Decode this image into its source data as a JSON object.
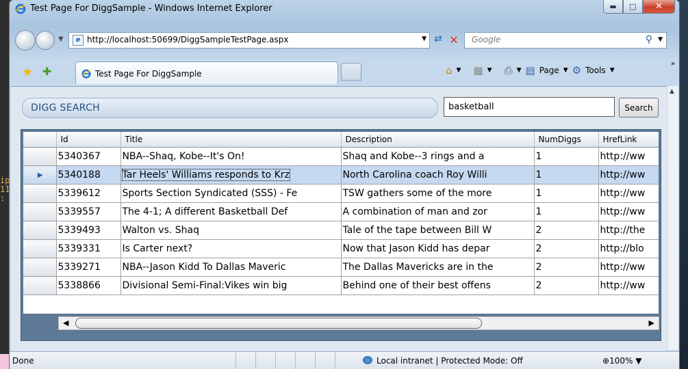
{
  "window": {
    "title": "Test Page For DiggSample - Windows Internet Explorer"
  },
  "address_bar": {
    "url": "http://localhost:50699/DiggSampleTestPage.aspx"
  },
  "search_box": {
    "placeholder": "Google"
  },
  "tab": {
    "title": "Test Page For DiggSample"
  },
  "command_bar": {
    "page_label": "Page",
    "tools_label": "Tools"
  },
  "page": {
    "header": "DIGG SEARCH",
    "query": "basketball",
    "search_button": "Search"
  },
  "grid": {
    "columns": [
      "Id",
      "Title",
      "Description",
      "NumDiggs",
      "HrefLink"
    ],
    "selected_row": 1,
    "rows": [
      {
        "id": "5340367",
        "title": "NBA--Shaq, Kobe--It's On!",
        "description": "Shaq and Kobe--3 rings and a",
        "diggs": "1",
        "href": "http://ww"
      },
      {
        "id": "5340188",
        "title": "Tar Heels' Williams responds to Krz",
        "description": "North Carolina coach Roy Willi",
        "diggs": "1",
        "href": "http://ww"
      },
      {
        "id": "5339612",
        "title": "Sports Section Syndicated (SSS) - Fe",
        "description": "TSW gathers some of the more",
        "diggs": "1",
        "href": "http://ww"
      },
      {
        "id": "5339557",
        "title": "The 4-1; A different Basketball Def",
        "description": "A combination of man and zor",
        "diggs": "1",
        "href": "http://ww"
      },
      {
        "id": "5339493",
        "title": "Walton vs. Shaq",
        "description": "Tale of the tape between Bill W",
        "diggs": "2",
        "href": "http://the"
      },
      {
        "id": "5339331",
        "title": "Is Carter next?",
        "description": "Now that Jason Kidd has depar",
        "diggs": "2",
        "href": "http://blo"
      },
      {
        "id": "5339271",
        "title": "NBA--Jason Kidd To Dallas Maveric",
        "description": "The Dallas Mavericks are in the",
        "diggs": "2",
        "href": "http://ww"
      },
      {
        "id": "5338866",
        "title": "Divisional Semi-Final:Vikes win big",
        "description": "Behind one of their best offens",
        "diggs": "2",
        "href": "http://ww"
      }
    ]
  },
  "status_bar": {
    "text": "Done",
    "zone": "Local intranet | Protected Mode: Off",
    "zoom": "100%"
  },
  "colors": {
    "digg_header_text": "#1f4f86",
    "grid_frame": "#5e7a96",
    "selected_row": "#c5d9f1"
  },
  "icons": [
    "ie-icon",
    "back-icon",
    "forward-icon",
    "refresh-icon",
    "stop-icon",
    "search-icon",
    "favorites-star-icon",
    "add-favorites-icon",
    "home-icon",
    "feeds-icon",
    "print-icon",
    "page-icon",
    "tools-icon",
    "row-pointer-icon",
    "zone-icon",
    "zoom-icon"
  ]
}
